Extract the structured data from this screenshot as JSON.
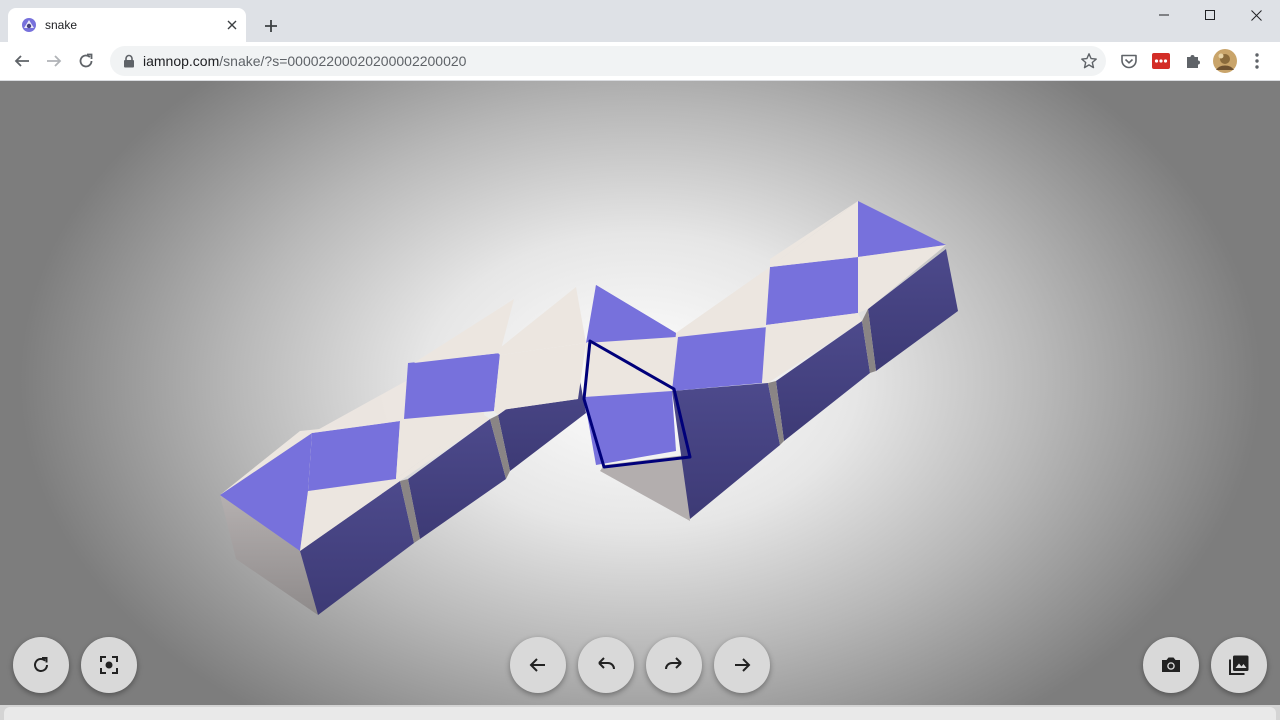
{
  "browser": {
    "tab": {
      "title": "snake",
      "favicon": "iamnop-logo-icon",
      "close": "close-tab-icon"
    },
    "new_tab_icon": "plus-icon",
    "window_controls": [
      "minimize-icon",
      "maximize-icon",
      "close-icon"
    ],
    "nav": [
      "back-icon",
      "forward-icon",
      "reload-icon"
    ],
    "address": {
      "host": "iamnop.com",
      "path": "/snake/?s=00002200020200002200020"
    },
    "extensions": [
      "pocket-icon",
      "lastpass-icon",
      "extensions-puzzle-icon",
      "profile-avatar",
      "kebab-menu-icon"
    ]
  },
  "app": {
    "puzzle": "snake",
    "state_code": "00002200020200002200020",
    "colors": {
      "purple_top": "#7771dc",
      "purple_side": "#45427e",
      "cream": "#ece6e0",
      "gray_side": "#a8a3a3",
      "highlight": "#00007a"
    },
    "controls_left": [
      {
        "name": "reset-button",
        "icon": "reset-rotate-icon"
      },
      {
        "name": "center-view-button",
        "icon": "focus-frame-icon"
      }
    ],
    "controls_center": [
      {
        "name": "previous-button",
        "icon": "arrow-left-icon"
      },
      {
        "name": "undo-button",
        "icon": "undo-icon"
      },
      {
        "name": "redo-button",
        "icon": "redo-icon"
      },
      {
        "name": "next-button",
        "icon": "arrow-right-icon"
      }
    ],
    "controls_right": [
      {
        "name": "screenshot-button",
        "icon": "camera-icon"
      },
      {
        "name": "gallery-button",
        "icon": "gallery-image-icon"
      }
    ]
  }
}
